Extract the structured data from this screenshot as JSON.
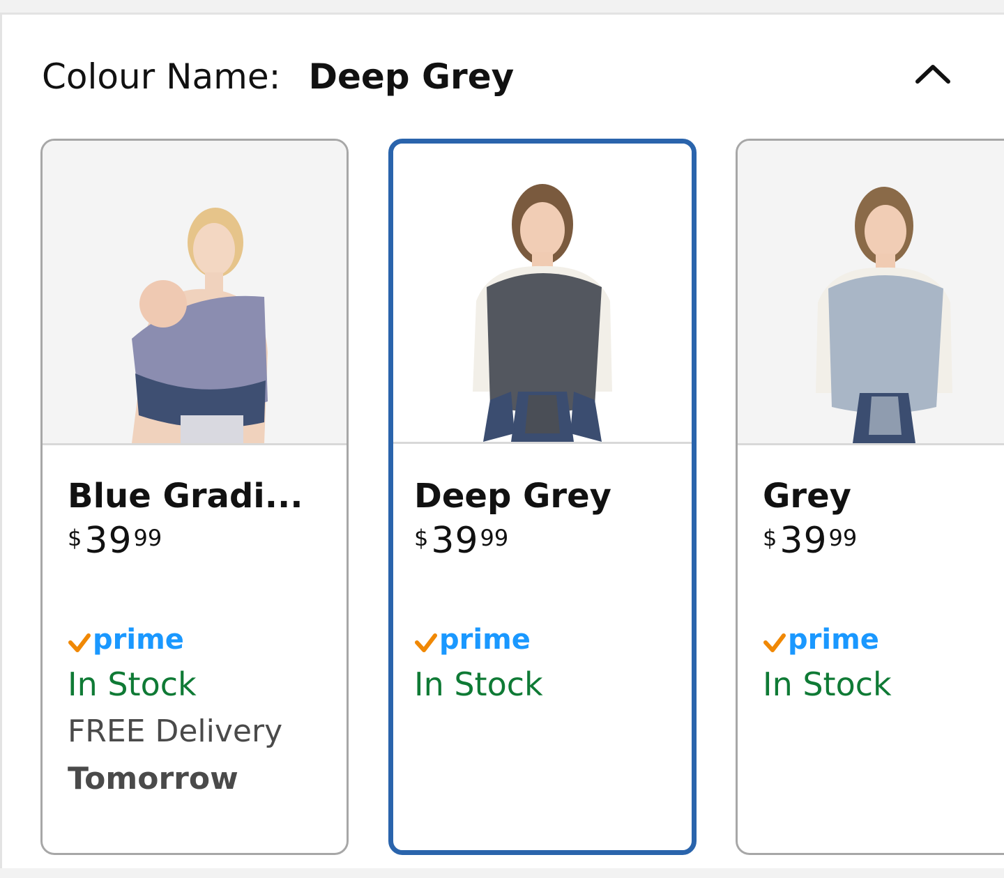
{
  "header": {
    "label": "Colour Name:",
    "selected_value": "Deep Grey"
  },
  "icons": {
    "collapse": "chevron-up-icon",
    "prime_check": "check-icon"
  },
  "colors": {
    "selected_border": "#2a64ac",
    "prime_blue": "#1a98ff",
    "prime_check": "#f08804",
    "in_stock_green": "#0f7a35"
  },
  "options": [
    {
      "name": "Blue Gradi...",
      "price_currency": "$",
      "price_whole": "39",
      "price_fraction": "99",
      "prime_label": "prime",
      "stock": "In Stock",
      "delivery": "FREE Delivery",
      "delivery_day": "Tomorrow",
      "selected": false
    },
    {
      "name": "Deep Grey",
      "price_currency": "$",
      "price_whole": "39",
      "price_fraction": "99",
      "prime_label": "prime",
      "stock": "In Stock",
      "selected": true
    },
    {
      "name": "Grey",
      "price_currency": "$",
      "price_whole": "39",
      "price_fraction": "99",
      "prime_label": "prime",
      "stock": "In Stock",
      "selected": false
    }
  ]
}
